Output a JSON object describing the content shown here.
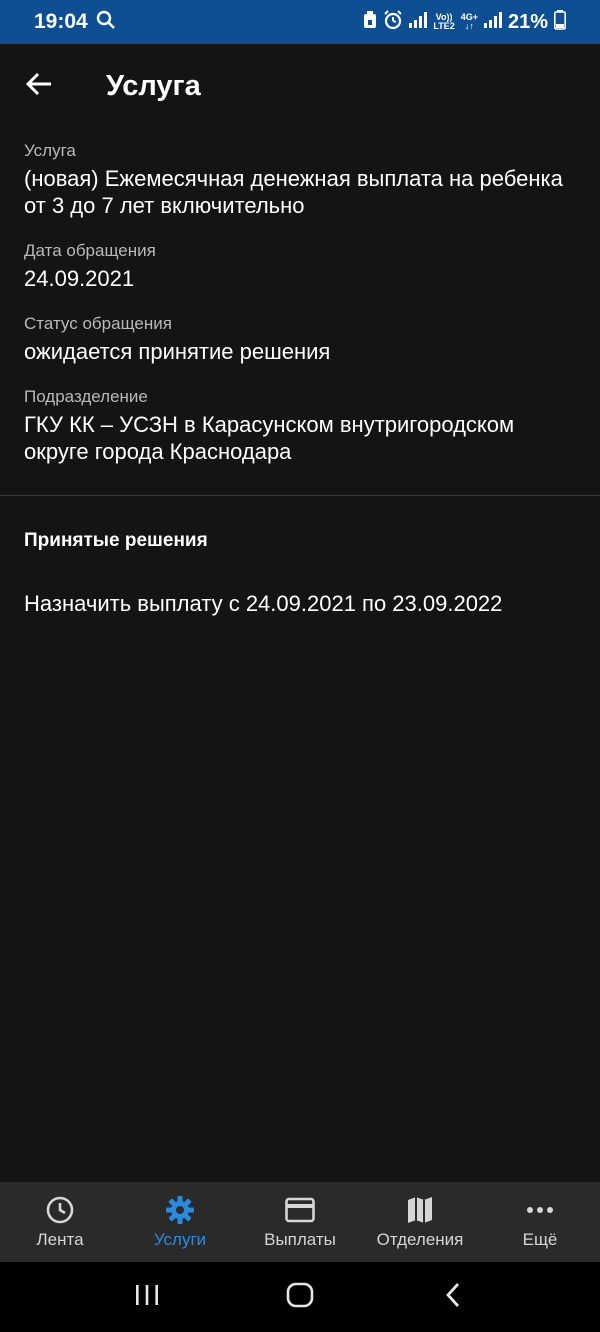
{
  "status_bar": {
    "time": "19:04",
    "volte": "Vo))",
    "lte": "LTE2",
    "net": "4G+",
    "battery": "21%"
  },
  "header": {
    "title": "Услуга"
  },
  "details": {
    "service_label": "Услуга",
    "service_value": "(новая) Ежемесячная денежная выплата на ребенка от 3 до 7 лет включительно",
    "date_label": "Дата обращения",
    "date_value": "24.09.2021",
    "status_label": "Статус обращения",
    "status_value": "ожидается принятие решения",
    "unit_label": "Подразделение",
    "unit_value": "ГКУ КК – УСЗН в Карасунском внутригородском округе города Краснодара"
  },
  "decisions": {
    "title": "Принятые решения",
    "items": [
      "Назначить выплату с 24.09.2021 по 23.09.2022"
    ]
  },
  "bottom_nav": {
    "items": [
      {
        "label": "Лента",
        "icon": "clock-icon"
      },
      {
        "label": "Услуги",
        "icon": "gear-icon",
        "active": true
      },
      {
        "label": "Выплаты",
        "icon": "card-icon"
      },
      {
        "label": "Отделения",
        "icon": "map-icon"
      },
      {
        "label": "Ещё",
        "icon": "more-icon"
      }
    ]
  },
  "colors": {
    "status_bar": "#0e4f94",
    "background": "#141414",
    "accent": "#2a8ae0",
    "nav_background": "#2a2a2a"
  }
}
